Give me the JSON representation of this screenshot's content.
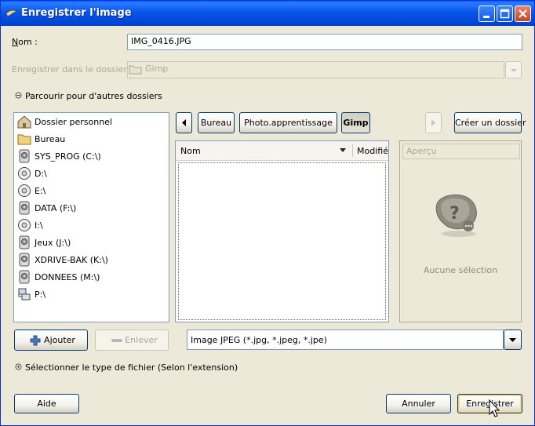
{
  "window": {
    "title": "Enregistrer l'image"
  },
  "name_field": {
    "label_prefix": "N",
    "label_rest": "om :",
    "value": "IMG_0416.JPG"
  },
  "save_in_folder": {
    "label": "Enregistrer dans le dossier :",
    "value": "Gimp"
  },
  "browse_toggle": {
    "label": "Parcourir pour d'autres dossiers"
  },
  "places": [
    {
      "label": "Dossier personnel",
      "icon": "home-icon"
    },
    {
      "label": "Bureau",
      "icon": "folder-icon"
    },
    {
      "label": "SYS_PROG (C:\\)",
      "icon": "hard-drive-icon"
    },
    {
      "label": "D:\\",
      "icon": "cd-drive-icon"
    },
    {
      "label": "E:\\",
      "icon": "cd-drive-icon"
    },
    {
      "label": "DATA (F:\\)",
      "icon": "hard-drive-icon"
    },
    {
      "label": "I:\\",
      "icon": "cd-drive-icon"
    },
    {
      "label": "Jeux (J:\\)",
      "icon": "hard-drive-icon"
    },
    {
      "label": "XDRIVE-BAK (K:\\)",
      "icon": "hard-drive-icon"
    },
    {
      "label": "DONNEES (M:\\)",
      "icon": "hard-drive-icon"
    },
    {
      "label": "P:\\",
      "icon": "network-drive-icon"
    }
  ],
  "path_bar": {
    "buttons": [
      "Bureau",
      "Photo.apprentissage",
      "Gimp"
    ],
    "active": "Gimp"
  },
  "create_folder": {
    "label": "Créer un dossier"
  },
  "file_list": {
    "columns": {
      "name": "Nom",
      "modified": "Modifié"
    }
  },
  "preview": {
    "header": "Aperçu",
    "empty_text": "Aucune sélection"
  },
  "add_button": {
    "label": "Ajouter"
  },
  "remove_button": {
    "label": "Enlever"
  },
  "file_filter": {
    "value": "Image JPEG (*.jpg, *.jpeg, *.jpe)"
  },
  "file_type_toggle": {
    "label": "Sélectionner le type de fichier (Selon l'extension)"
  },
  "help_button": {
    "label": "Aide"
  },
  "cancel_button": {
    "label": "Annuler"
  },
  "save_button": {
    "label": "Enregistrer"
  }
}
